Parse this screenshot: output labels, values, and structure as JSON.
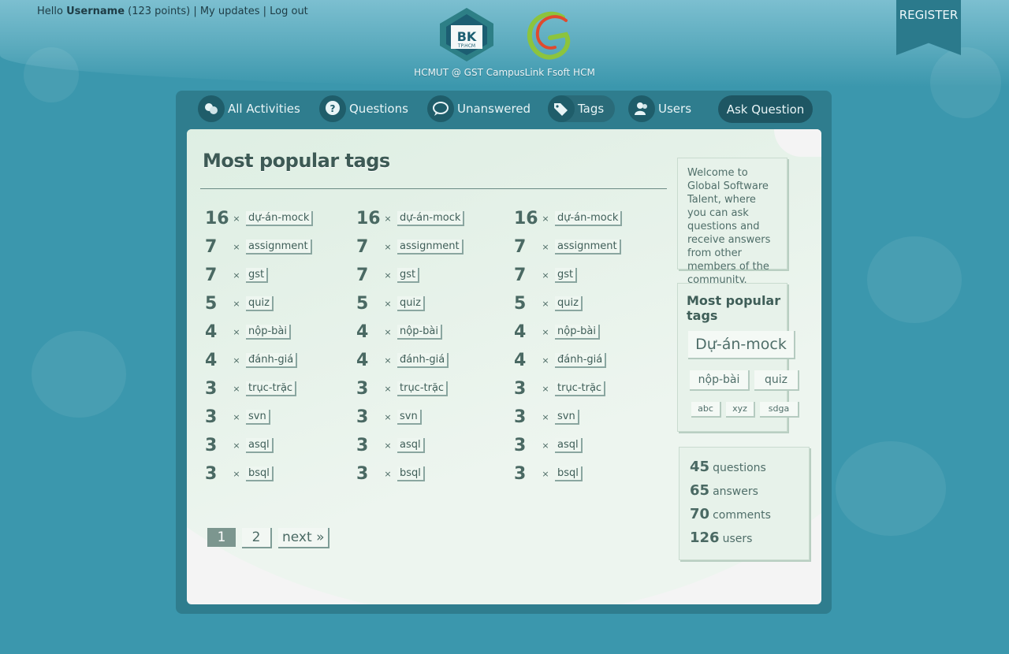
{
  "user": {
    "greeting": "Hello",
    "username": "Username",
    "points": "(123 points)",
    "separator": "|",
    "my_updates": "My updates",
    "logout": "Log out"
  },
  "logo": {
    "bk_text": "BK",
    "bk_sub": "TP.HCM"
  },
  "site_title": "HCMUT @ GST CampusLink Fsoft HCM",
  "register": "REGISTER",
  "nav": {
    "all_activities": "All Activities",
    "questions": "Questions",
    "unanswered": "Unanswered",
    "tags": "Tags",
    "users": "Users",
    "ask": "Ask Question"
  },
  "page_title": "Most popular tags",
  "times_symbol": "×",
  "tags": [
    {
      "count": "16",
      "name": "dự-án-mock"
    },
    {
      "count": "7",
      "name": "assignment"
    },
    {
      "count": "7",
      "name": "gst"
    },
    {
      "count": "5",
      "name": "quiz"
    },
    {
      "count": "4",
      "name": "nộp-bài"
    },
    {
      "count": "4",
      "name": "đánh-giá"
    },
    {
      "count": "3",
      "name": "trục-trặc"
    },
    {
      "count": "3",
      "name": "svn"
    },
    {
      "count": "3",
      "name": "asql"
    },
    {
      "count": "3",
      "name": "bsql"
    }
  ],
  "pagination": {
    "page1": "1",
    "page2": "2",
    "next": "next »"
  },
  "sidebar": {
    "welcome": "Welcome to Global Software Talent, where you can ask questions and receive answers from other members of the community.",
    "popular_title": "Most popular tags",
    "popular_tags": [
      "Dự-án-mock",
      "nộp-bài",
      "quiz",
      "abc",
      "xyz",
      "sdga"
    ],
    "stats": [
      {
        "value": "45",
        "label": "questions"
      },
      {
        "value": "65",
        "label": "answers"
      },
      {
        "value": "70",
        "label": "comments"
      },
      {
        "value": "126",
        "label": "users"
      }
    ]
  },
  "colors": {
    "background": "#3b97ad",
    "nav_dark": "#1e5663",
    "accent_text": "#4a6963"
  }
}
